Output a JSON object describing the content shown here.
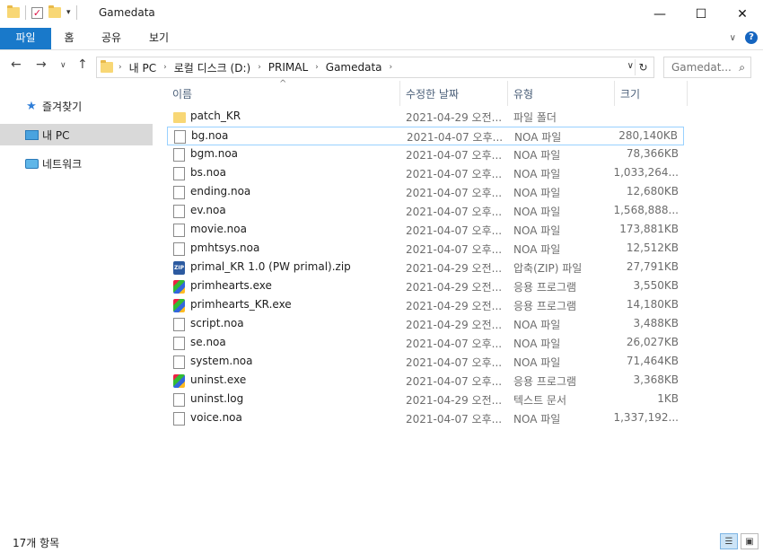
{
  "window": {
    "title": "Gamedata"
  },
  "ribbon": {
    "tabs": {
      "file": "파일",
      "home": "홈",
      "share": "공유",
      "view": "보기"
    }
  },
  "address": {
    "crumbs": [
      "내 PC",
      "로컬 디스크 (D:)",
      "PRIMAL",
      "Gamedata"
    ]
  },
  "search": {
    "placeholder": "Gamedat..."
  },
  "sidebar": {
    "items": [
      {
        "label": "즐겨찾기",
        "icon": "star-icon"
      },
      {
        "label": "내 PC",
        "icon": "pc-icon"
      },
      {
        "label": "네트워크",
        "icon": "network-icon"
      }
    ]
  },
  "columns": {
    "name": "이름",
    "date": "수정한 날짜",
    "type": "유형",
    "size": "크기"
  },
  "files": [
    {
      "name": "patch_KR",
      "date": "2021-04-29 오전...",
      "type": "파일 폴더",
      "size": "",
      "icon": "folder"
    },
    {
      "name": "bg.noa",
      "date": "2021-04-07 오후...",
      "type": "NOA 파일",
      "size": "280,140KB",
      "icon": "doc"
    },
    {
      "name": "bgm.noa",
      "date": "2021-04-07 오후...",
      "type": "NOA 파일",
      "size": "78,366KB",
      "icon": "doc"
    },
    {
      "name": "bs.noa",
      "date": "2021-04-07 오후...",
      "type": "NOA 파일",
      "size": "1,033,264...",
      "icon": "doc"
    },
    {
      "name": "ending.noa",
      "date": "2021-04-07 오후...",
      "type": "NOA 파일",
      "size": "12,680KB",
      "icon": "doc"
    },
    {
      "name": "ev.noa",
      "date": "2021-04-07 오후...",
      "type": "NOA 파일",
      "size": "1,568,888...",
      "icon": "doc"
    },
    {
      "name": "movie.noa",
      "date": "2021-04-07 오후...",
      "type": "NOA 파일",
      "size": "173,881KB",
      "icon": "doc"
    },
    {
      "name": "pmhtsys.noa",
      "date": "2021-04-07 오후...",
      "type": "NOA 파일",
      "size": "12,512KB",
      "icon": "doc"
    },
    {
      "name": "primal_KR 1.0 (PW primal).zip",
      "date": "2021-04-29 오전...",
      "type": "압축(ZIP) 파일",
      "size": "27,791KB",
      "icon": "zip"
    },
    {
      "name": "primhearts.exe",
      "date": "2021-04-29 오전...",
      "type": "응용 프로그램",
      "size": "3,550KB",
      "icon": "exe"
    },
    {
      "name": "primhearts_KR.exe",
      "date": "2021-04-29 오전...",
      "type": "응용 프로그램",
      "size": "14,180KB",
      "icon": "exe"
    },
    {
      "name": "script.noa",
      "date": "2021-04-29 오전...",
      "type": "NOA 파일",
      "size": "3,488KB",
      "icon": "doc"
    },
    {
      "name": "se.noa",
      "date": "2021-04-07 오후...",
      "type": "NOA 파일",
      "size": "26,027KB",
      "icon": "doc"
    },
    {
      "name": "system.noa",
      "date": "2021-04-07 오후...",
      "type": "NOA 파일",
      "size": "71,464KB",
      "icon": "doc"
    },
    {
      "name": "uninst.exe",
      "date": "2021-04-07 오후...",
      "type": "응용 프로그램",
      "size": "3,368KB",
      "icon": "exe"
    },
    {
      "name": "uninst.log",
      "date": "2021-04-29 오전...",
      "type": "텍스트 문서",
      "size": "1KB",
      "icon": "doc"
    },
    {
      "name": "voice.noa",
      "date": "2021-04-07 오후...",
      "type": "NOA 파일",
      "size": "1,337,192...",
      "icon": "doc"
    }
  ],
  "status": {
    "count_text": "17개 항목"
  }
}
